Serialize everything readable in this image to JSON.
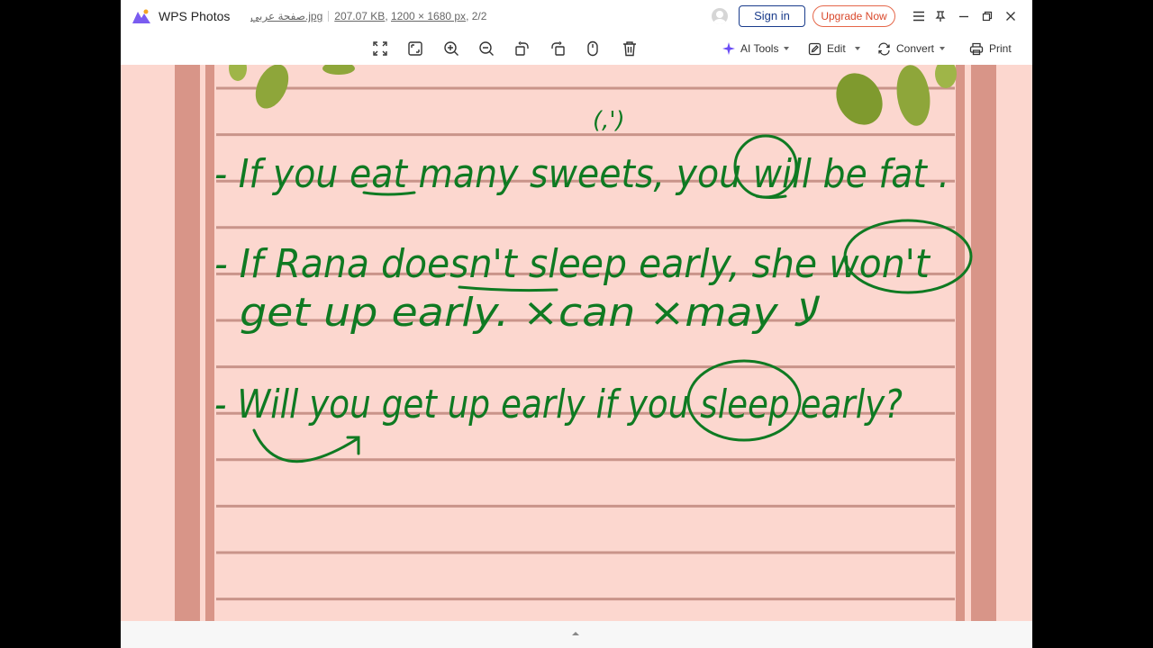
{
  "app": {
    "name": "WPS Photos"
  },
  "file": {
    "name": "صفحة عربي.jpg",
    "size": "207.07 KB",
    "dimensions": "1200 × 1680 px",
    "page": "2/2"
  },
  "account": {
    "signin_label": "Sign in",
    "upgrade_label": "Upgrade Now"
  },
  "toolbar": {
    "tools": [
      "fit-screen-icon",
      "actual-size-icon",
      "zoom-in-icon",
      "zoom-out-icon",
      "rotate-left-icon",
      "rotate-right-icon",
      "slideshow-icon",
      "delete-icon"
    ],
    "ai_tools_label": "AI Tools",
    "edit_label": "Edit",
    "convert_label": "Convert",
    "print_label": "Print"
  },
  "notebook": {
    "lines": [
      "- If you eat many sweets, you will be fat .",
      "- If Rana doesn't sleep early, she won't",
      "get up early.   ×can  ×may  لا",
      "- Will you get up early if you sleep early?"
    ],
    "annotation": "(,')"
  },
  "colors": {
    "ink": "#0f7a22",
    "paper": "#fcd7cf",
    "rule": "#c9948a",
    "margin_stripe": "#d9968a",
    "accent": "#1a3c8c",
    "upgrade": "#e5674a"
  }
}
